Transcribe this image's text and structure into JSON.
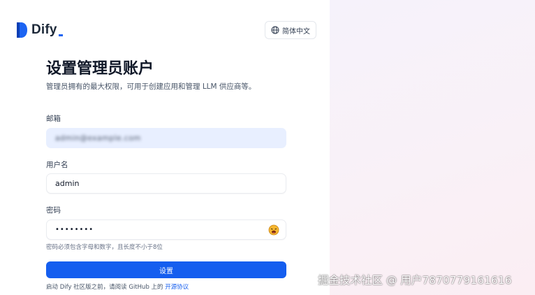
{
  "brand": {
    "name": "Dify",
    "accent": "#155eef"
  },
  "language_button": {
    "label": "简体中文",
    "icon": "globe-icon"
  },
  "page": {
    "title": "设置管理员账户",
    "subtitle": "管理员拥有的最大权限，可用于创建应用和管理 LLM 供应商等。"
  },
  "form": {
    "email": {
      "label": "邮箱",
      "value": "admin@example.com"
    },
    "username": {
      "label": "用户名",
      "value": "admin"
    },
    "password": {
      "label": "密码",
      "value": "••••••••",
      "hint": "密码必须包含字母和数字，且长度不小于8位",
      "toggle_icon": "eye-toggle-icon"
    },
    "submit_label": "设置"
  },
  "footer": {
    "text": "启动 Dify 社区版之前，请阅读 GitHub 上的",
    "link_label": "开源协议"
  },
  "watermark": "掘金技术社区 @ 用户7870779161616"
}
